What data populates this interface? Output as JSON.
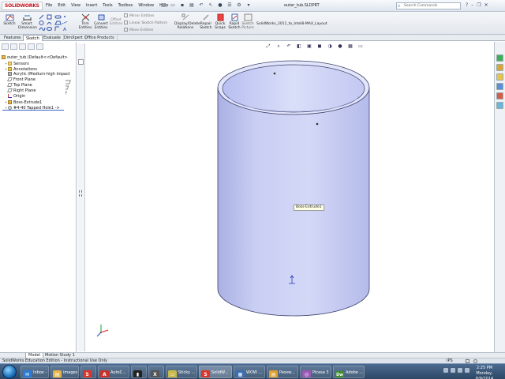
{
  "window": {
    "brand": "SOLIDWORKS",
    "title": "outer_tub.SLDPRT",
    "menus": [
      "File",
      "Edit",
      "View",
      "Insert",
      "Tools",
      "Toolbox",
      "Window",
      "Help"
    ],
    "search_placeholder": "Search Commands"
  },
  "command_manager": {
    "sketch": "Sketch",
    "smart_dimension": "Smart Dimension",
    "trim_entities": "Trim Entities",
    "convert_entities": "Convert Entities",
    "offset_entities": "Offset Entities",
    "mirror_entities": "Mirror Entities",
    "linear_sketch_pattern": "Linear Sketch Pattern",
    "move_entities": "Move Entities",
    "display_delete_relations": "Display/Delete Relations",
    "repair_sketch": "Repair Sketch",
    "quick_snaps": "Quick Snaps",
    "rapid_sketch": "Rapid Sketch",
    "sketch_picture": "Sketch Picture",
    "layout_label": "SolidWorks_2011_to_Intel8-MAX_Layout"
  },
  "tabs": [
    "Features",
    "Sketch",
    "Evaluate",
    "DimXpert",
    "Office Products"
  ],
  "active_tab": "Sketch",
  "feature_tree": [
    {
      "label": "outer_tub  (Default<<Default>",
      "type": "part"
    },
    {
      "label": "Sensors",
      "type": "folder"
    },
    {
      "label": "Annotations",
      "type": "folder"
    },
    {
      "label": "Acrylic (Medium-high impact",
      "type": "material"
    },
    {
      "label": "Front Plane",
      "type": "plane"
    },
    {
      "label": "Top Plane",
      "type": "plane"
    },
    {
      "label": "Right Plane",
      "type": "plane"
    },
    {
      "label": "Origin",
      "type": "origin"
    },
    {
      "label": "Boss-Extrude1",
      "type": "feature"
    },
    {
      "label": "#4-40 Tapped Hole1 ->",
      "type": "feature"
    }
  ],
  "graphics": {
    "tooltip": "Boss-Extrude1"
  },
  "model_tabs": [
    "Model",
    "Motion Study 1"
  ],
  "status": {
    "left": "SolidWorks Education Edition - Instructional Use Only",
    "units": "IPS"
  },
  "taskbar": {
    "items": [
      {
        "label": "Inbox -",
        "color": "#2a7bd5",
        "glyph": "✉"
      },
      {
        "label": "images",
        "color": "#e8b44a",
        "glyph": "▤"
      },
      {
        "label": "",
        "color": "#d9352b",
        "glyph": "S"
      },
      {
        "label": "AutoC...",
        "color": "#c8322b",
        "glyph": "A"
      },
      {
        "label": "",
        "color": "#222",
        "glyph": "▮"
      },
      {
        "label": "",
        "color": "#555",
        "glyph": "X"
      },
      {
        "label": "Sticky ...",
        "color": "#e7d86a",
        "glyph": "▭"
      },
      {
        "label": "SolidW...",
        "color": "#d9352b",
        "glyph": "S"
      },
      {
        "label": "WOW ...",
        "color": "#3a6fb5",
        "glyph": "▦"
      },
      {
        "label": "Passw...",
        "color": "#e0a030",
        "glyph": "▤"
      },
      {
        "label": "Picasa 3",
        "color": "#9b59b6",
        "glyph": "◎"
      },
      {
        "label": "Adobe ...",
        "color": "#3c8d2f",
        "glyph": "Dw"
      }
    ],
    "time": "2:25 PM",
    "date": "Monday, 8/9/2014"
  },
  "colors": {
    "tub_body": "#c8cdf0",
    "tub_shadow": "#a9b0e0",
    "tub_top": "#e0e4fb",
    "brand_red": "#c1121f",
    "taskbar": "#3a5678"
  }
}
